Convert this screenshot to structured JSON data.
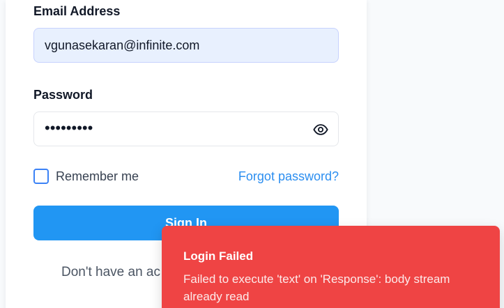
{
  "form": {
    "email_label": "Email Address",
    "email_value": "vgunasekaran@infinite.com",
    "password_label": "Password",
    "password_value": "•••••••••",
    "password_toggle_icon": "eye-icon",
    "remember_label": "Remember me",
    "remember_checked": false,
    "forgot_label": "Forgot password?",
    "signin_label": "Sign In",
    "signup_prompt": "Don't have an ac"
  },
  "toast": {
    "title": "Login Failed",
    "message": "Failed to execute 'text' on 'Response': body stream already read"
  },
  "colors": {
    "primary": "#2196f3",
    "link": "#2b8ef0",
    "error": "#ef4444",
    "email_field_bg": "#e8f0fe"
  }
}
